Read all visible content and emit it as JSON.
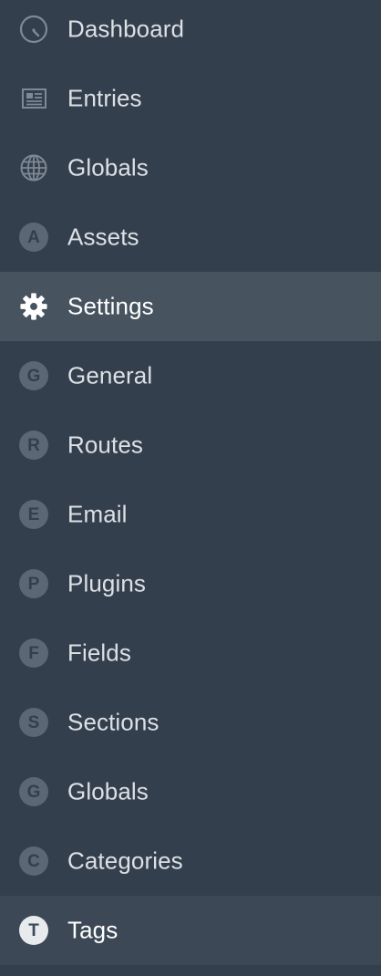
{
  "nav": {
    "main": [
      {
        "label": "Dashboard",
        "icon": "dashboard-gauge-icon"
      },
      {
        "label": "Entries",
        "icon": "entries-newspaper-icon"
      },
      {
        "label": "Globals",
        "icon": "globe-icon"
      },
      {
        "label": "Assets",
        "icon": "assets-letter-icon",
        "letter": "A"
      }
    ],
    "settings": {
      "label": "Settings",
      "icon": "gear-icon"
    },
    "sub": [
      {
        "label": "General",
        "letter": "G"
      },
      {
        "label": "Routes",
        "letter": "R"
      },
      {
        "label": "Email",
        "letter": "E"
      },
      {
        "label": "Plugins",
        "letter": "P"
      },
      {
        "label": "Fields",
        "letter": "F"
      },
      {
        "label": "Sections",
        "letter": "S"
      },
      {
        "label": "Globals",
        "letter": "G"
      },
      {
        "label": "Categories",
        "letter": "C"
      },
      {
        "label": "Tags",
        "letter": "T"
      }
    ]
  },
  "colors": {
    "background": "#333f4d",
    "selected": "#47535f",
    "active": "#3c4855",
    "text": "#dce0e4",
    "badge": "#5b6774"
  }
}
